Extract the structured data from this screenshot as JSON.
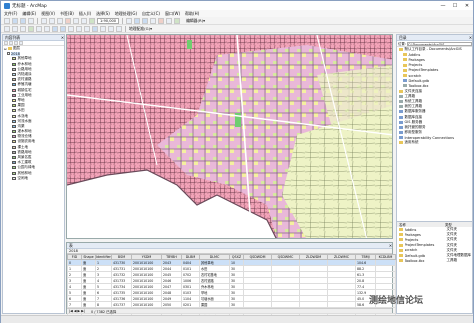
{
  "window": {
    "title": "无标题 - ArcMap",
    "minimize": "—",
    "maximize": "☐",
    "close": "✕"
  },
  "menu": [
    "文件(F)",
    "编辑(E)",
    "视图(V)",
    "书签(B)",
    "插入(I)",
    "选择(S)",
    "地理处理(G)",
    "自定义(C)",
    "窗口(W)",
    "帮助(H)"
  ],
  "toolbar": {
    "scale": "1:90,000",
    "editor": "编辑器(R)▾",
    "georef": "地理配准(G)▾"
  },
  "toc": {
    "title": "内容列表",
    "layers_root": "图层",
    "dataset": "2018",
    "items": [
      {
        "label": "其他草地",
        "color": "#d7e9a0"
      },
      {
        "label": "乔木林地",
        "color": "#8fcf6c"
      },
      {
        "label": "公路用地",
        "color": "#c9c9c9"
      },
      {
        "label": "内陆滩涂",
        "color": "#bfe3f2"
      },
      {
        "label": "农村道路",
        "color": "#d6c7a8"
      },
      {
        "label": "养殖坑塘",
        "color": "#74b6e0"
      },
      {
        "label": "城镇住宅",
        "color": "#f2a3b8"
      },
      {
        "label": "工业用地",
        "color": "#c98fb7"
      },
      {
        "label": "旱地",
        "color": "#f5f0a0"
      },
      {
        "label": "果园",
        "color": "#b9d97a"
      },
      {
        "label": "水田",
        "color": "#e3f0b0"
      },
      {
        "label": "水浇地",
        "color": "#eef3c6"
      },
      {
        "label": "河流水面",
        "color": "#9fd0f0"
      },
      {
        "label": "沟渠",
        "color": "#8fc3e8"
      },
      {
        "label": "灌木林地",
        "color": "#a7d68a"
      },
      {
        "label": "物流仓储",
        "color": "#d9a6cf"
      },
      {
        "label": "设施农用地",
        "color": "#e6dca0"
      },
      {
        "label": "裸土地",
        "color": "#e0d0b8"
      },
      {
        "label": "铁路用地",
        "color": "#b0b0b0"
      },
      {
        "label": "风景名胜",
        "color": "#99cc88"
      },
      {
        "label": "水工建筑",
        "color": "#7fa7c8"
      },
      {
        "label": "公园与绿地",
        "color": "#a8db8f"
      },
      {
        "label": "其他林地",
        "color": "#b5dd96"
      },
      {
        "label": "空闲地",
        "color": "#eeeeee"
      }
    ]
  },
  "table": {
    "title": "表",
    "tab": "2018",
    "columns": [
      "FID",
      "Shape",
      "Identifier",
      "BSM",
      "YSDM",
      "TBYBH",
      "DLBM",
      "DLMC",
      "QSXZ",
      "QSDWDM",
      "QSDWMC",
      "ZLDWDM",
      "ZLDWMC",
      "TBMJ",
      "KCDLBM"
    ],
    "rows": [
      [
        "0",
        "面",
        "1",
        "431730",
        "2001010100",
        "2043",
        "0404",
        "其他草地",
        "10",
        "",
        "",
        "",
        "",
        "104.6",
        ""
      ],
      [
        "1",
        "面",
        "2",
        "431731",
        "2001010100",
        "2044",
        "0101",
        "水田",
        "30",
        "",
        "",
        "",
        "",
        "88.2",
        ""
      ],
      [
        "2",
        "面",
        "3",
        "431732",
        "2001010100",
        "2045",
        "0702",
        "农村宅基地",
        "30",
        "",
        "",
        "",
        "",
        "61.3",
        ""
      ],
      [
        "3",
        "面",
        "4",
        "431733",
        "2001010100",
        "2046",
        "1006",
        "农村道路",
        "30",
        "",
        "",
        "",
        "",
        "20.8",
        ""
      ],
      [
        "4",
        "面",
        "5",
        "431734",
        "2001010100",
        "2047",
        "0301",
        "乔木林地",
        "30",
        "",
        "",
        "",
        "",
        "77.4",
        ""
      ],
      [
        "5",
        "面",
        "6",
        "431735",
        "2001010100",
        "2048",
        "0103",
        "旱地",
        "30",
        "",
        "",
        "",
        "",
        "132.9",
        ""
      ],
      [
        "6",
        "面",
        "7",
        "431736",
        "2001010100",
        "2049",
        "1104",
        "坑塘水面",
        "30",
        "",
        "",
        "",
        "",
        "45.0",
        ""
      ],
      [
        "7",
        "面",
        "8",
        "431737",
        "2001010100",
        "2050",
        "0201",
        "果园",
        "30",
        "",
        "",
        "",
        "",
        "58.6",
        ""
      ],
      [
        "8",
        "面",
        "9",
        "431738",
        "2001010100",
        "2051",
        "0701",
        "城镇住宅",
        "20",
        "",
        "",
        "",
        "",
        "39.1",
        ""
      ],
      [
        "9",
        "面",
        "10",
        "431739",
        "2001010100",
        "2052",
        "1202",
        "设施农用地",
        "30",
        "",
        "",
        "",
        "",
        "12.7",
        ""
      ]
    ],
    "footer": "0 / 7382 已选择",
    "footer_tab": "2018"
  },
  "catalog": {
    "title": "目录",
    "location": "位置:",
    "location_value": "C:\\Documents\\ArcGIS",
    "items": [
      {
        "label": "默认工作目录 - Documents\\ArcGIS",
        "kind": "folder"
      },
      {
        "label": "AddIns",
        "kind": "folder"
      },
      {
        "label": "Packages",
        "kind": "folder"
      },
      {
        "label": "Projects",
        "kind": "folder"
      },
      {
        "label": "ProjectTemplates",
        "kind": "folder"
      },
      {
        "label": "scratch",
        "kind": "folder"
      },
      {
        "label": "Default.gdb",
        "kind": "db"
      },
      {
        "label": "Toolbox.tbx",
        "kind": "tb"
      },
      {
        "label": "文件夹连接",
        "kind": "folder"
      },
      {
        "label": "工具箱",
        "kind": "tb"
      },
      {
        "label": "系统工具箱",
        "kind": "tb"
      },
      {
        "label": "我的工具箱",
        "kind": "tb"
      },
      {
        "label": "数据库服务器",
        "kind": "db"
      },
      {
        "label": "数据库连接",
        "kind": "db"
      },
      {
        "label": "GIS 服务器",
        "kind": "db"
      },
      {
        "label": "我托管的服务",
        "kind": "db"
      },
      {
        "label": "即用型服务",
        "kind": "db"
      },
      {
        "label": "Interoperability Connections",
        "kind": "db"
      },
      {
        "label": "适用系统",
        "kind": "folder"
      }
    ],
    "contents_header": [
      "名称",
      "类型"
    ],
    "contents": [
      [
        "AddIns",
        "文件夹"
      ],
      [
        "Packages",
        "文件夹"
      ],
      [
        "Projects",
        "文件夹"
      ],
      [
        "ProjectTemplates",
        "文件夹"
      ],
      [
        "scratch",
        "文件夹"
      ],
      [
        "Default.gdb",
        "文件地理数据库"
      ],
      [
        "Toolbox.tbx",
        "工具箱"
      ]
    ]
  },
  "status": {
    "coords": "",
    "units": ""
  },
  "watermark": "测绘地信论坛",
  "colors": {
    "residential": "#f2a3b8",
    "farmland": "#eef3c6",
    "water": "#9fd0f0",
    "forest": "#8fcf6c"
  }
}
